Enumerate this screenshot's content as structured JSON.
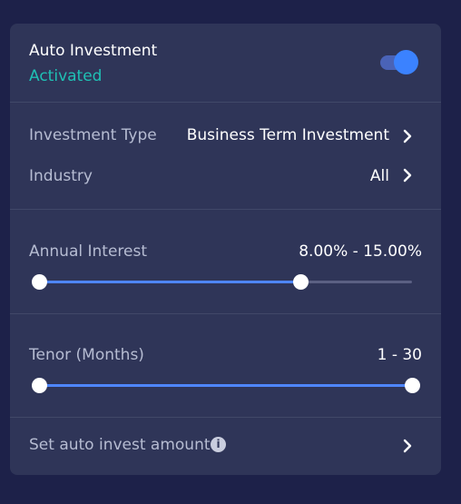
{
  "auto_investment": {
    "title": "Auto Investment",
    "status": "Activated",
    "enabled": true
  },
  "investment_type": {
    "label": "Investment Type",
    "value": "Business Term Investment"
  },
  "industry": {
    "label": "Industry",
    "value": "All"
  },
  "annual_interest": {
    "label": "Annual Interest",
    "value": "8.00% - 15.00%",
    "range_start_fraction": 0,
    "range_end_fraction": 0.7
  },
  "tenor": {
    "label": "Tenor (Months)",
    "value": "1 - 30",
    "range_start_fraction": 0,
    "range_end_fraction": 1
  },
  "auto_invest_amount": {
    "label": "Set auto invest amount",
    "info_icon": "info-icon",
    "chevron_icon": "chevron-right-icon"
  },
  "colors": {
    "background": "#1d2149",
    "card": "#2f3558",
    "accent": "#3b82ff",
    "status": "#1fc0b4"
  }
}
